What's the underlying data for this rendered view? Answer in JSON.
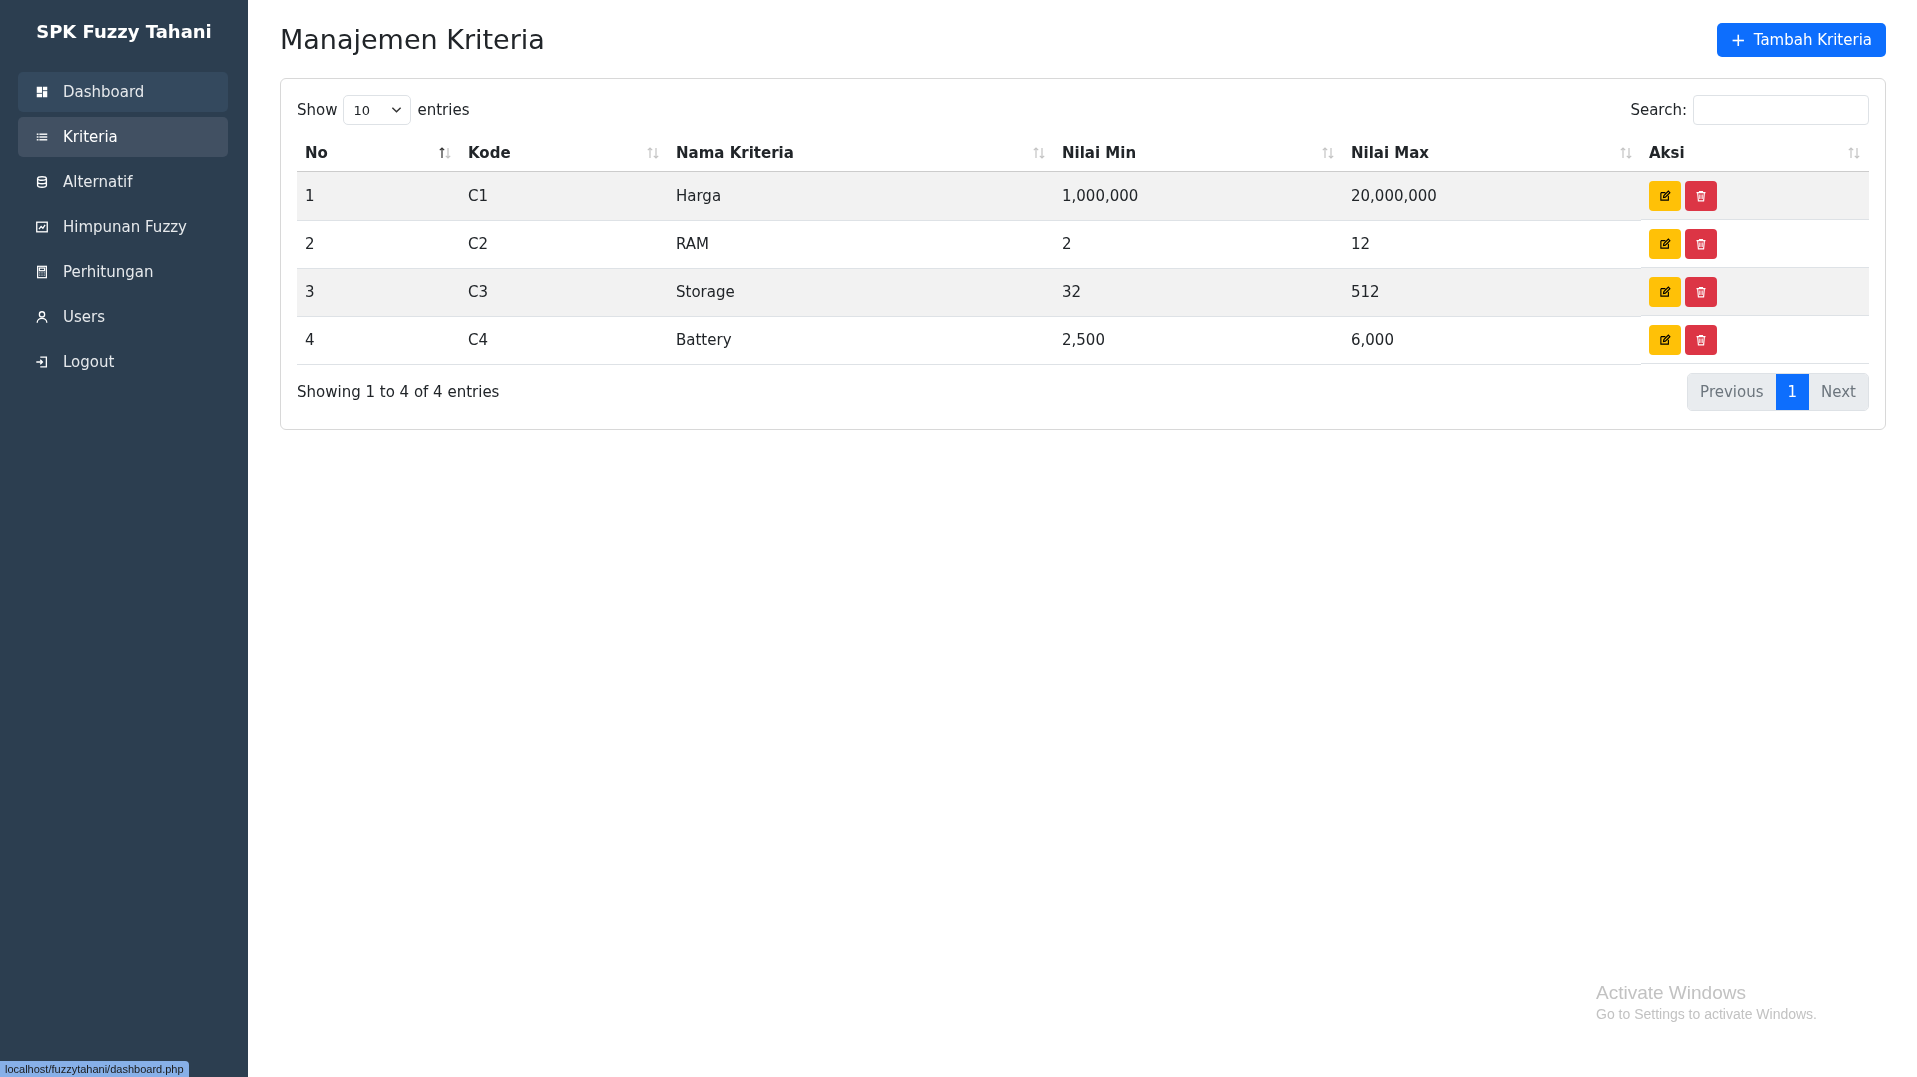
{
  "sidebar": {
    "brand": "SPK Fuzzy Tahani",
    "items": [
      {
        "label": "Dashboard",
        "kind": "grid",
        "selected": false,
        "hovered": true
      },
      {
        "label": "Kriteria",
        "kind": "list",
        "selected": true,
        "hovered": false
      },
      {
        "label": "Alternatif",
        "kind": "database",
        "selected": false,
        "hovered": false
      },
      {
        "label": "Himpunan Fuzzy",
        "kind": "chart",
        "selected": false,
        "hovered": false
      },
      {
        "label": "Perhitungan",
        "kind": "calculator",
        "selected": false,
        "hovered": false
      },
      {
        "label": "Users",
        "kind": "user",
        "selected": false,
        "hovered": false
      },
      {
        "label": "Logout",
        "kind": "logout",
        "selected": false,
        "hovered": false
      }
    ]
  },
  "page": {
    "title": "Manajemen Kriteria",
    "add_button": {
      "icon": "+",
      "label": "Tambah Kriteria"
    }
  },
  "table": {
    "length": {
      "before": "Show",
      "value": "10",
      "after": "entries"
    },
    "search": {
      "label": "Search:"
    },
    "columns": [
      {
        "label": "No",
        "sorted": true
      },
      {
        "label": "Kode",
        "sorted": false
      },
      {
        "label": "Nama Kriteria",
        "sorted": false
      },
      {
        "label": "Nilai Min",
        "sorted": false
      },
      {
        "label": "Nilai Max",
        "sorted": false
      },
      {
        "label": "Aksi",
        "sorted": false
      }
    ],
    "rows": [
      [
        "1",
        "C1",
        "Harga",
        "1,000,000",
        "20,000,000"
      ],
      [
        "2",
        "C2",
        "RAM",
        "2",
        "12"
      ],
      [
        "3",
        "C3",
        "Storage",
        "32",
        "512"
      ],
      [
        "4",
        "C4",
        "Battery",
        "2,500",
        "6,000"
      ]
    ],
    "info": "Showing 1 to 4 of 4 entries",
    "pagination": [
      {
        "label": "Previous",
        "selected": false
      },
      {
        "label": "1",
        "selected": true
      },
      {
        "label": "Next",
        "selected": false
      }
    ]
  },
  "status_bar": {
    "url": "localhost/fuzzytahani/dashboard.php"
  },
  "os_notice": {
    "title": "Activate Windows",
    "text": "Go to Settings to activate Windows."
  }
}
